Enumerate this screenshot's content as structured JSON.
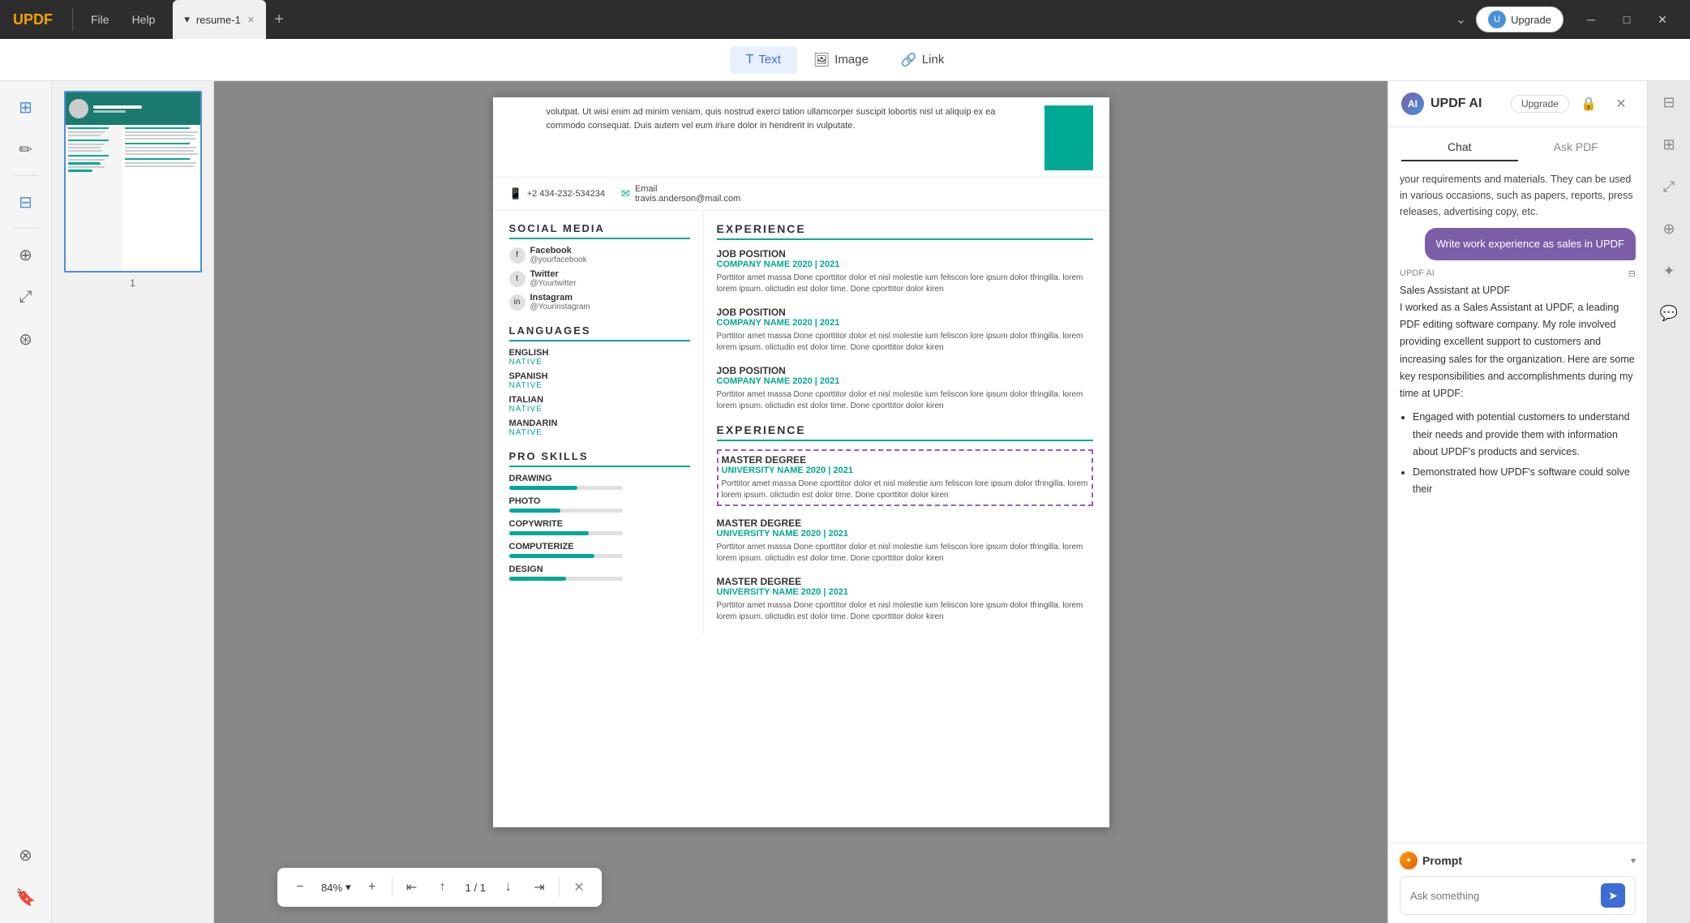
{
  "titleBar": {
    "logo": "UPDF",
    "divider": "|",
    "menuItems": [
      "File",
      "Help"
    ],
    "tab": {
      "label": "resume-1",
      "arrow": "▾",
      "close": "✕"
    },
    "tabAdd": "+",
    "tabListBtn": "⌄",
    "upgradeBtn": "Upgrade",
    "avatarInitial": "U",
    "winMin": "─",
    "winMax": "□",
    "winClose": "✕"
  },
  "leftSidebar": {
    "icons": [
      {
        "name": "document-icon",
        "glyph": "⊞"
      },
      {
        "name": "draw-icon",
        "glyph": "✏"
      },
      {
        "name": "edit-icon",
        "glyph": "⊟"
      },
      {
        "name": "organize-icon",
        "glyph": "⊕"
      },
      {
        "name": "convert-icon",
        "glyph": "⤢"
      },
      {
        "name": "protect-icon",
        "glyph": "⊛"
      },
      {
        "name": "layers-icon",
        "glyph": "⊗"
      },
      {
        "name": "bookmark-icon",
        "glyph": "🔖"
      }
    ]
  },
  "thumbnailPanel": {
    "pageNum": "1"
  },
  "toolbar": {
    "textBtn": "Text",
    "imageBtn": "Image",
    "linkBtn": "Link",
    "textIcon": "T",
    "imageIcon": "🖼",
    "linkIcon": "🔗"
  },
  "bottomToolbar": {
    "zoomOut": "−",
    "zoomValue": "84%",
    "zoomIn": "+",
    "zoomDropIcon": "▾",
    "navFirst": "⇤",
    "navPrev": "↑",
    "navNext": "↓",
    "navLast": "⇥",
    "pageDisplay": "1 / 1",
    "closeBtn": "✕"
  },
  "resume": {
    "contactItems": [
      {
        "icon": "📞",
        "text": "+2 434-232-534234"
      },
      {
        "icon": "✉",
        "label": "Email",
        "text": "travis.anderson@mail.com"
      }
    ],
    "socialMedia": {
      "title": "SOCIAL MEDIA",
      "items": [
        {
          "platform": "Facebook",
          "handle": "@yourfacebook"
        },
        {
          "platform": "Twitter",
          "handle": "@Yourtwitter"
        },
        {
          "platform": "Instagram",
          "handle": "@Yourinstagram"
        }
      ]
    },
    "languages": {
      "title": "LANGUAGES",
      "items": [
        {
          "name": "ENGLISH",
          "level": "NATIVE"
        },
        {
          "name": "SPANISH",
          "level": "NATIVE"
        },
        {
          "name": "ITALIAN",
          "level": "NATIVE"
        },
        {
          "name": "MANDARIN",
          "level": "NATIVE"
        }
      ]
    },
    "proSkills": {
      "title": "PRO SKILLS",
      "items": [
        {
          "name": "DRAWING",
          "percent": 60
        },
        {
          "name": "PHOTO",
          "percent": 45
        },
        {
          "name": "COPYWRITE",
          "percent": 70
        },
        {
          "name": "COMPUTERIZE",
          "percent": 75
        },
        {
          "name": "DESIGN",
          "percent": 50
        }
      ]
    },
    "experience1": {
      "title": "EXPERIENCE",
      "items": [
        {
          "jobTitle": "JOB POSITION",
          "company": "COMPANY NAME 2020 | 2021",
          "desc": "Porttitor amet massa Done cporttitor dolor et nisl molestie ium feliscon lore ipsum dolor tfringilla. lorem lorem ipsum. olictudin est dolor time. Done cporttitor dolor kiren"
        },
        {
          "jobTitle": "JOB POSITION",
          "company": "COMPANY NAME 2020 | 2021",
          "desc": "Porttitor amet massa Done cporttitor dolor et nisl molestie ium feliscon lore ipsum dolor tfringilla. lorem lorem ipsum. olictudin est dolor time. Done cporttitor dolor kiren"
        },
        {
          "jobTitle": "JOB POSITION",
          "company": "COMPANY NAME 2020 | 2021",
          "desc": "Porttitor amet massa Done cporttitor dolor et nisl molestie ium feliscon lore ipsum dolor tfringilla. lorem lorem ipsum. olictudin est dolor time. Done cporttitor dolor kiren"
        }
      ]
    },
    "experience2": {
      "title": "EXPERIENCE",
      "items": [
        {
          "jobTitle": "MASTER DEGREE",
          "company": "UNIVERSITY NAME 2020 | 2021",
          "desc": "Porttitor amet massa Done cporttitor dolor et nisl molestie ium feliscon lore ipsum dolor tfringilla. lorem lorem ipsum. olictudin est dolor time. Done cporttitor dolor kiren",
          "selected": true
        },
        {
          "jobTitle": "MASTER DEGREE",
          "company": "UNIVERSITY NAME 2020 | 2021",
          "desc": "Porttitor amet massa Done cporttitor dolor et nisl molestie ium feliscon lore ipsum dolor tfringilla. lorem lorem ipsum. olictudin est dolor time. Done cporttitor dolor kiren",
          "selected": false
        },
        {
          "jobTitle": "MASTER DEGREE",
          "company": "UNIVERSITY NAME 2020 | 2021",
          "desc": "Porttitor amet massa Done cporttitor dolor et nisl molestie ium feliscon lore ipsum dolor tfringilla. lorem lorem ipsum. olictudin est dolor time. Done cporttitor dolor kiren",
          "selected": false
        }
      ]
    },
    "topText": "volutpat. Ut wisi enim ad minim veniam, quis nostrud exerci tation ullamcorper suscipit lobortis nisl ut aliquip ex ea commodo consequat. Duis autem vel eum iriure dolor in hendrerit in vulputate."
  },
  "rightPanel": {
    "title": "UPDF AI",
    "upgradeBtn": "Upgrade",
    "tabs": [
      "Chat",
      "Ask PDF"
    ],
    "activeTab": "Chat",
    "chatHistory": {
      "precedingText": "your requirements and materials. They can be used in various occasions, such as papers, reports, press releases, advertising copy, etc.",
      "userMessage": "Write work experience as sales in UPDF",
      "aiLabel": "UPDF AI",
      "aiResponse": {
        "intro": "Sales Assistant at UPDF\nI worked as a Sales Assistant at UPDF, a leading PDF editing software company. My role involved providing excellent support to customers and increasing sales for the organization. Here are some key responsibilities and accomplishments during my time at UPDF:",
        "bullets": [
          "Engaged with potential customers to understand their needs and provide them with information about UPDF's products and services.",
          "Demonstrated how UPDF's software could solve their"
        ]
      }
    },
    "prompt": {
      "label": "Prompt",
      "chevron": "▾",
      "inputPlaceholder": "Ask something",
      "sendIcon": "➤"
    },
    "sideIcons": [
      {
        "name": "history-icon",
        "glyph": "⊟"
      },
      {
        "name": "settings-icon",
        "glyph": "⊞"
      },
      {
        "name": "export-icon",
        "glyph": "⤢"
      },
      {
        "name": "share-icon",
        "glyph": "⊕"
      },
      {
        "name": "star-icon",
        "glyph": "✦"
      },
      {
        "name": "chat-bubble-icon",
        "glyph": "💬"
      }
    ]
  }
}
